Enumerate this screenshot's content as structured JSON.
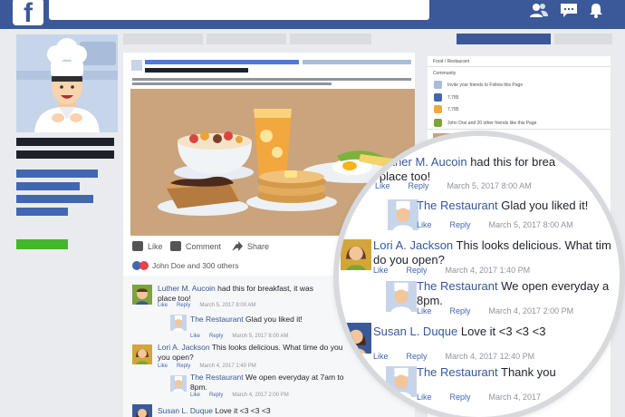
{
  "topbar": {
    "logo": "f",
    "icons": [
      "friends-icon",
      "messages-icon",
      "notifications-icon"
    ]
  },
  "post": {
    "actions": {
      "like": "Like",
      "comment": "Comment",
      "share": "Share"
    },
    "reactions_text": "John Doe and 300 others"
  },
  "sidebar_right": {
    "category": "Food / Restaurant",
    "section": "Community",
    "items": [
      {
        "icon": "invite-icon",
        "text": "Invite your friends to Follow this Page"
      },
      {
        "icon": "thumbs-up-icon",
        "text": "7,785"
      },
      {
        "icon": "rss-icon",
        "text": "7,785"
      },
      {
        "icon": "friends-like-icon",
        "text": "John Doe and 20 other friends like this Page"
      }
    ]
  },
  "comments": [
    {
      "name": "Luther M. Aucoin",
      "text": "had this for breakfast, it was",
      "text2": "place too!",
      "like": "Like",
      "reply": "Reply",
      "time": "March 5, 2017 8:00 AM"
    },
    {
      "name": "The Restaurant",
      "text": "Glad you liked it!",
      "like": "Like",
      "reply": "Reply",
      "time": "March 5, 2017 8:00 AM"
    },
    {
      "name": "Lori A. Jackson",
      "text": "This looks delicious. What time do you",
      "text2": "you open?",
      "like": "Like",
      "reply": "Reply",
      "time": "March 4, 2017 1:40 PM"
    },
    {
      "name": "The Restaurant",
      "text": "We open everyday at 7am to",
      "text2": "8pm.",
      "like": "Like",
      "reply": "Reply",
      "time": "March 4, 2017 2:00 PM"
    },
    {
      "name": "Susan L. Duque",
      "text": "Love it <3 <3 <3"
    }
  ],
  "magnified": [
    {
      "name": "Luther M. Aucoin",
      "text": "had this for brea",
      "text2": "e place too!",
      "like": "Like",
      "reply": "Reply",
      "time": "March 5, 2017 8:00 AM"
    },
    {
      "name": "The Restaurant",
      "text": "Glad you liked it!",
      "like": "Like",
      "reply": "Reply",
      "time": "March 5, 2017 8:00 AM"
    },
    {
      "name": "Lori A. Jackson",
      "text": "This looks delicious. What tim",
      "text2": "do you open?",
      "like": "Like",
      "reply": "Reply",
      "time": "March 4, 2017 1:40 PM"
    },
    {
      "name": "The Restaurant",
      "text": "We open everyday a",
      "text2": "8pm.",
      "like": "Like",
      "reply": "Reply",
      "time": "March 4, 2017 2:00 PM"
    },
    {
      "name": "Susan L. Duque",
      "text": "Love it <3 <3 <3",
      "like": "Like",
      "reply": "Reply",
      "time": "March 4, 2017 12:40 PM"
    },
    {
      "name": "The Restaurant",
      "text": "Thank you",
      "like": "Like",
      "reply": "Reply",
      "time": "March 4, 2017"
    }
  ],
  "colors": {
    "brand": "#3b5998",
    "link": "#365899",
    "green": "#42b72a"
  }
}
